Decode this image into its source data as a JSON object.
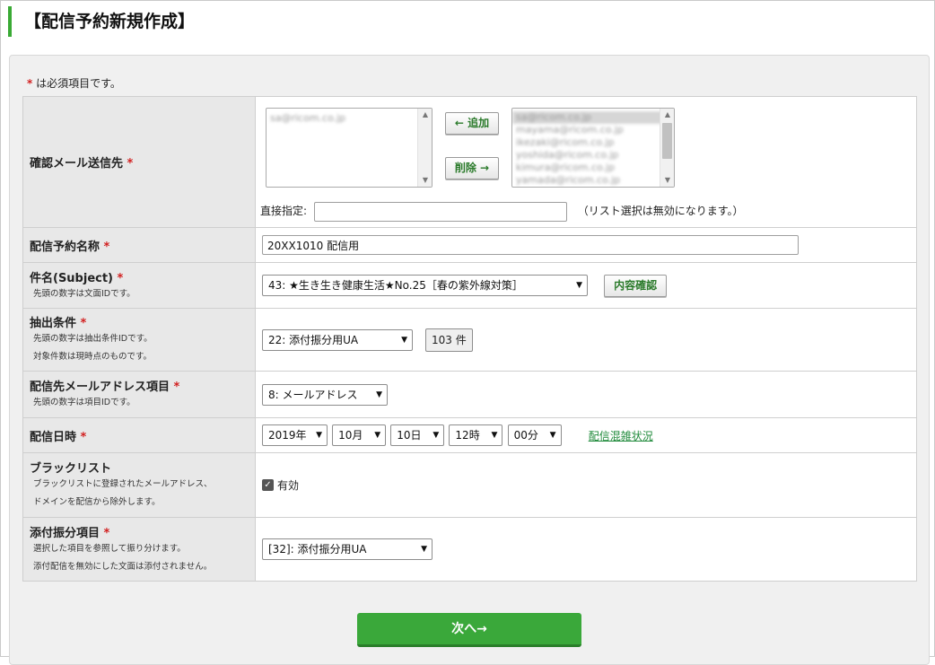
{
  "page": {
    "title": "【配信予約新規作成】"
  },
  "required_note": {
    "mark": "*",
    "text": "は必須項目です。"
  },
  "fields": {
    "confirm_mail": {
      "label": "確認メール送信先",
      "left_list": [
        "sa@ricom.co.jp"
      ],
      "add_button": "← 追加",
      "remove_button": "削除 →",
      "right_list": [
        "sa@ricom.co.jp",
        "mayama@ricom.co.jp",
        "ikezaki@ricom.co.jp",
        "yoshida@ricom.co.jp",
        "kimura@ricom.co.jp",
        "yamada@ricom.co.jp"
      ],
      "direct_label": "直接指定:",
      "direct_value": "",
      "direct_note": "（リスト選択は無効になります。）"
    },
    "reservation_name": {
      "label": "配信予約名称",
      "value": "20XX1010 配信用"
    },
    "subject": {
      "label": "件名(Subject)",
      "note": "先頭の数字は文面IDです。",
      "selected": "43: ★生き生き健康生活★No.25［春の紫外線対策］",
      "confirm_button": "内容確認"
    },
    "extract": {
      "label": "抽出条件",
      "notes": [
        "先頭の数字は抽出条件IDです。",
        "対象件数は現時点のものです。"
      ],
      "selected": "22: 添付振分用UA",
      "count": "103 件"
    },
    "mail_address": {
      "label": "配信先メールアドレス項目",
      "note": "先頭の数字は項目IDです。",
      "selected": "8: メールアドレス"
    },
    "datetime": {
      "label": "配信日時",
      "year": "2019年",
      "month": "10月",
      "day": "10日",
      "hour": "12時",
      "minute": "00分",
      "status_link": "配信混雑状況"
    },
    "blacklist": {
      "label": "ブラックリスト",
      "notes": [
        "ブラックリストに登録されたメールアドレス、",
        "ドメインを配信から除外します。"
      ],
      "checkbox_label": "有効",
      "checked": true
    },
    "attachment": {
      "label": "添付振分項目",
      "notes": [
        "選択した項目を参照して振り分けます。",
        "添付配信を無効にした文面は添付されません。"
      ],
      "selected": "[32]: 添付振分用UA"
    }
  },
  "next_button": "次へ→",
  "colors": {
    "accent": "#3aaa35",
    "required": "#d21f1f",
    "link": "#1f8a3a",
    "button": "#3aa83a"
  }
}
